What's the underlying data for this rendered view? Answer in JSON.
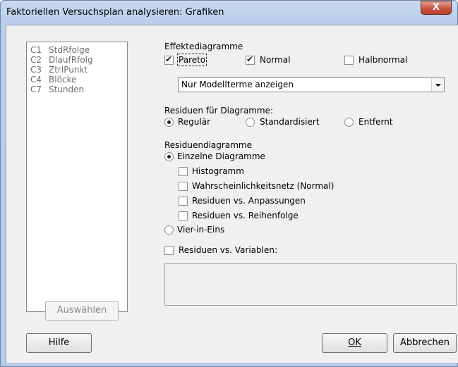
{
  "window": {
    "title": "Faktoriellen Versuchsplan analysieren: Grafiken",
    "close_glyph": "X"
  },
  "variables": [
    {
      "col": "C1",
      "name": "StdRfolge"
    },
    {
      "col": "C2",
      "name": "DlaufRfolg"
    },
    {
      "col": "C3",
      "name": "ZtrlPunkt"
    },
    {
      "col": "C4",
      "name": "Blöcke"
    },
    {
      "col": "C7",
      "name": "Stunden"
    }
  ],
  "effects": {
    "heading": "Effektediagramme",
    "pareto": {
      "label": "Pareto",
      "checked": true
    },
    "normal": {
      "label": "Normal",
      "checked": true
    },
    "halfnormal": {
      "label": "Halbnormal",
      "checked": false
    },
    "dropdown_value": "Nur Modellterme anzeigen"
  },
  "residuals_for_plots": {
    "heading": "Residuen für Diagramme:",
    "options": [
      "Regulär",
      "Standardisiert",
      "Entfernt"
    ],
    "selected": "Regulär"
  },
  "residual_plots": {
    "heading": "Residuendiagramme",
    "individual": "Einzelne Diagramme",
    "histogram": "Histogramm",
    "normal_prob": "Wahrscheinlichkeitsnetz (Normal)",
    "vs_fits": "Residuen vs. Anpassungen",
    "vs_order": "Residuen vs. Reihenfolge",
    "four_in_one": "Vier-in-Eins",
    "vs_variables": "Residuen vs. Variablen:"
  },
  "buttons": {
    "select": "Auswählen",
    "help": "Hilfe",
    "ok": "OK",
    "cancel": "Abbrechen"
  }
}
